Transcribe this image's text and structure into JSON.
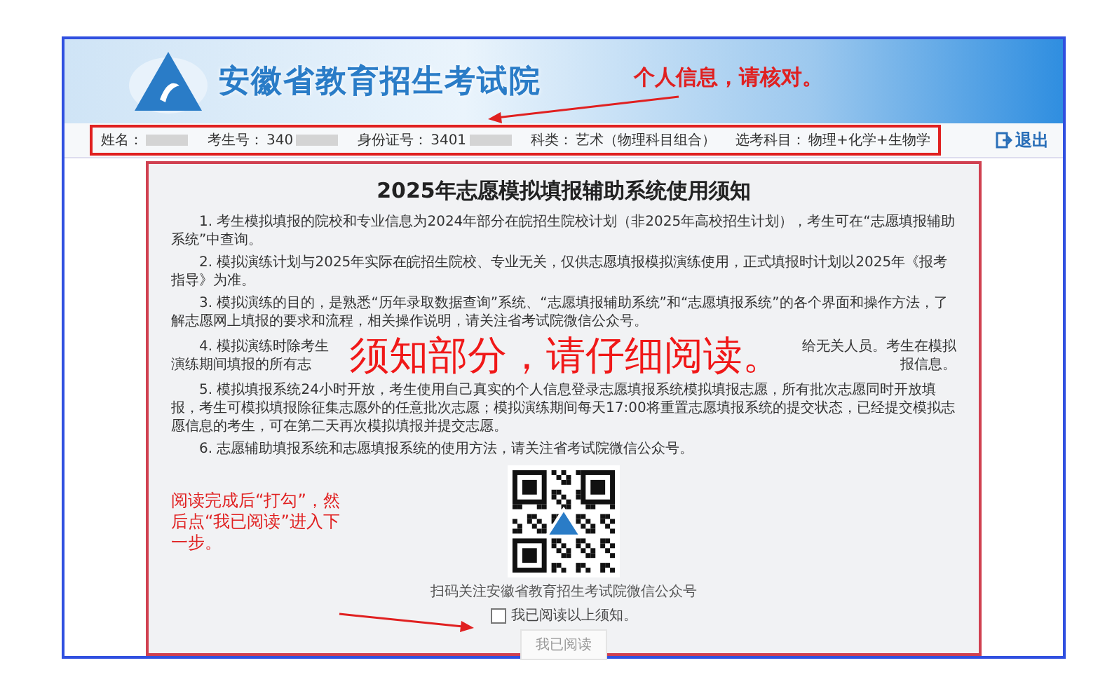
{
  "header": {
    "title": "安徽省教育招生考试院",
    "annotation": "个人信息，请核对。"
  },
  "info_bar": {
    "fields": [
      {
        "label": "姓名：",
        "redacted": true
      },
      {
        "label": "考生号：",
        "value": "340",
        "redacted": true
      },
      {
        "label": "身份证号：",
        "value": "3401",
        "redacted": true
      },
      {
        "label": "科类：",
        "value": "艺术（物理科目组合）"
      },
      {
        "label": "选考科目：",
        "value": "物理+化学+生物学"
      }
    ],
    "logout": "退出"
  },
  "notice": {
    "title": "2025年志愿模拟填报辅助系统使用须知",
    "items": [
      {
        "kind": "text",
        "text": "1. 考生模拟填报的院校和专业信息为2024年部分在皖招生院校计划（非2025年高校招生计划），考生可在“志愿填报辅助系统”中查询。"
      },
      {
        "kind": "text",
        "text": "2. 模拟演练计划与2025年实际在皖招生院校、专业无关，仅供志愿填报模拟演练使用，正式填报时计划以2025年《报考指导》为准。"
      },
      {
        "kind": "text",
        "text": "3. 模拟演练的目的，是熟悉“历年录取数据查询”系统、“志愿填报辅助系统”和“志愿填报系统”的各个界面和操作方法，了解志愿网上填报的要求和流程，相关操作说明，请关注省考试院微信公众号。"
      },
      {
        "kind": "covered",
        "lines": [
          {
            "left": "4. 模拟演练时除考生",
            "right": "给无关人员。考生在模拟"
          },
          {
            "left": "演练期间填报的所有志",
            "right": "报信息。"
          }
        ]
      },
      {
        "kind": "text",
        "text": "5. 模拟填报系统24小时开放，考生使用自己真实的个人信息登录志愿填报系统模拟填报志愿，所有批次志愿同时开放填报，考生可模拟填报除征集志愿外的任意批次志愿；模拟演练期间每天17:00将重置志愿填报系统的提交状态，已经提交模拟志愿信息的考生，可在第二天再次模拟填报并提交志愿。"
      },
      {
        "kind": "text",
        "text": "6. 志愿辅助填报系统和志愿填报系统的使用方法，请关注省考试院微信公众号。"
      }
    ],
    "overlay_annotation": "须知部分，请仔细阅读。",
    "qr_caption": "扫码关注安徽省教育招生考试院微信公众号",
    "agree": {
      "label": "我已阅读以上须知。",
      "checked": false
    },
    "button": {
      "label": "我已阅读",
      "disabled": true
    },
    "side_annotation": "阅读完成后“打勾”，然后点“我已阅读”进入下一步。"
  }
}
